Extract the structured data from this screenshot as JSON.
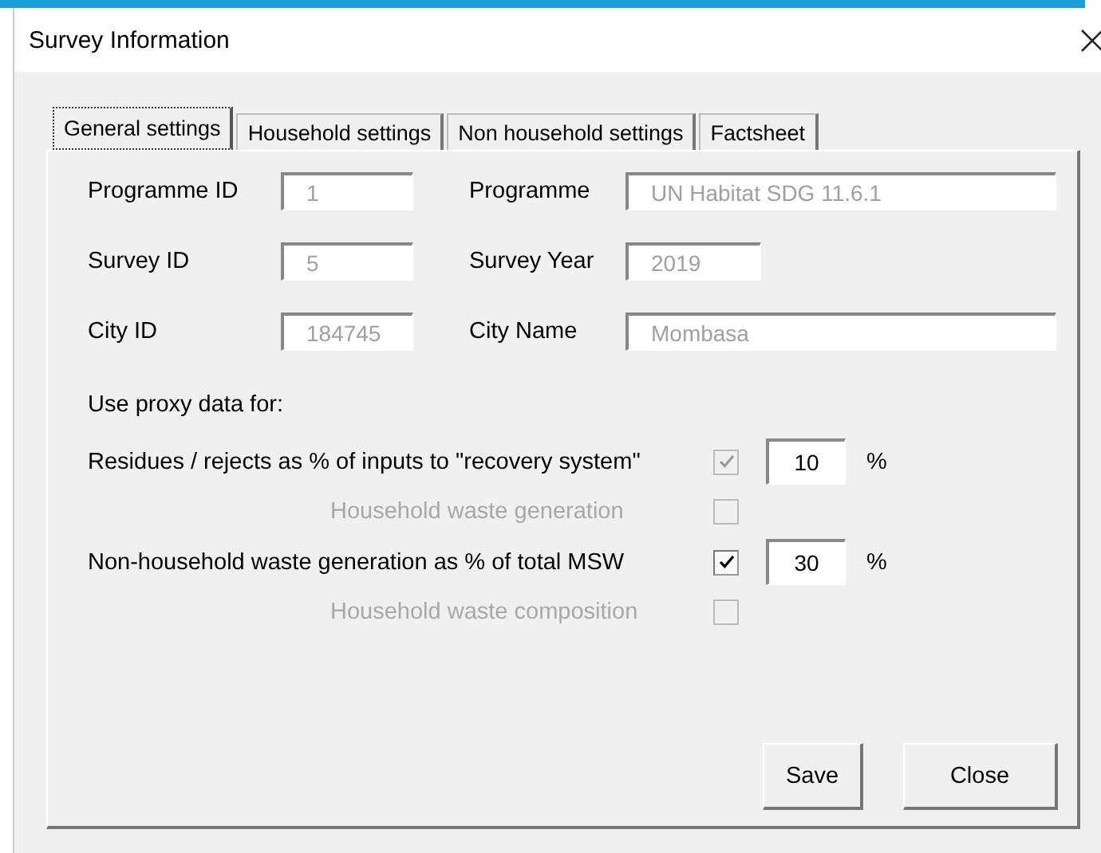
{
  "window": {
    "title": "Survey Information"
  },
  "tabs": [
    {
      "label": "General settings",
      "selected": true
    },
    {
      "label": "Household settings",
      "selected": false
    },
    {
      "label": "Non household settings",
      "selected": false
    },
    {
      "label": "Factsheet",
      "selected": false
    }
  ],
  "fields": [
    {
      "label": "Programme ID",
      "value": "1",
      "label_2": "Programme",
      "value_2": "UN Habitat SDG 11.6.1",
      "wide_2": true
    },
    {
      "label": "Survey ID",
      "value": "5",
      "label_2": "Survey Year",
      "value_2": "2019",
      "wide_2": false
    },
    {
      "label": "City ID",
      "value": "184745",
      "label_2": "City Name",
      "value_2": "Mombasa",
      "wide_2": true
    }
  ],
  "proxy_heading": "Use proxy data for:",
  "proxy_items": [
    {
      "label": "Residues / rejects as % of inputs to \"recovery system\"",
      "checked": true,
      "disabled": false,
      "checkbox_disabled": true,
      "value": "10",
      "unit": "%"
    },
    {
      "label": "Household waste generation",
      "checked": false,
      "disabled": true,
      "checkbox_disabled": true
    },
    {
      "label": "Non-household waste generation as % of total MSW",
      "checked": true,
      "disabled": false,
      "checkbox_disabled": false,
      "value": "30",
      "unit": "%"
    },
    {
      "label": "Household waste composition",
      "checked": false,
      "disabled": true,
      "checkbox_disabled": true
    }
  ],
  "buttons": [
    "Save",
    "Close"
  ]
}
